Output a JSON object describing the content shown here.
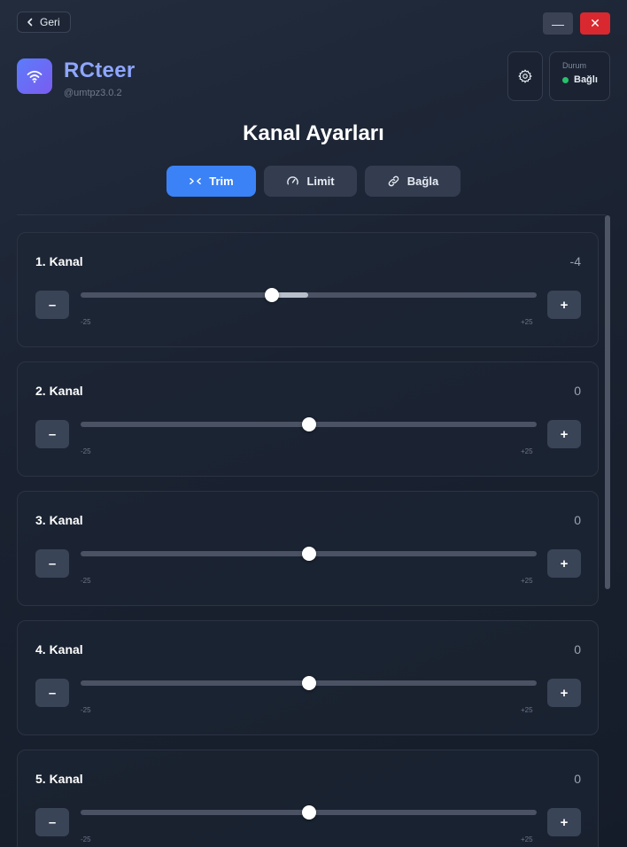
{
  "topbar": {
    "back_label": "Geri",
    "minimize_glyph": "—",
    "close_glyph": "✕"
  },
  "brand": {
    "icon": "wifi-icon",
    "name": "RCteer",
    "handle": "@umtpz3.0.2"
  },
  "status": {
    "title": "Durum",
    "value": "Bağlı",
    "color": "#27c26c"
  },
  "settings_icon": "gear-icon",
  "page_title": "Kanal Ayarları",
  "tabs": [
    {
      "label": "Trim",
      "icon": "trim-arrows-icon",
      "active": true
    },
    {
      "label": "Limit",
      "icon": "gauge-icon",
      "active": false
    },
    {
      "label": "Bağla",
      "icon": "link-icon",
      "active": false
    }
  ],
  "range": {
    "min": -25,
    "max": 25,
    "min_label": "-25",
    "max_label": "+25"
  },
  "stepper": {
    "minus": "–",
    "plus": "+"
  },
  "channels": [
    {
      "name": "1. Kanal",
      "value": "-4",
      "trim": -4
    },
    {
      "name": "2. Kanal",
      "value": "0",
      "trim": 0
    },
    {
      "name": "3. Kanal",
      "value": "0",
      "trim": 0
    },
    {
      "name": "4. Kanal",
      "value": "0",
      "trim": 0
    },
    {
      "name": "5. Kanal",
      "value": "0",
      "trim": 0
    }
  ],
  "colors": {
    "accent": "#3b82f6",
    "brand_text": "#8fa6ff",
    "close": "#d9282f"
  }
}
